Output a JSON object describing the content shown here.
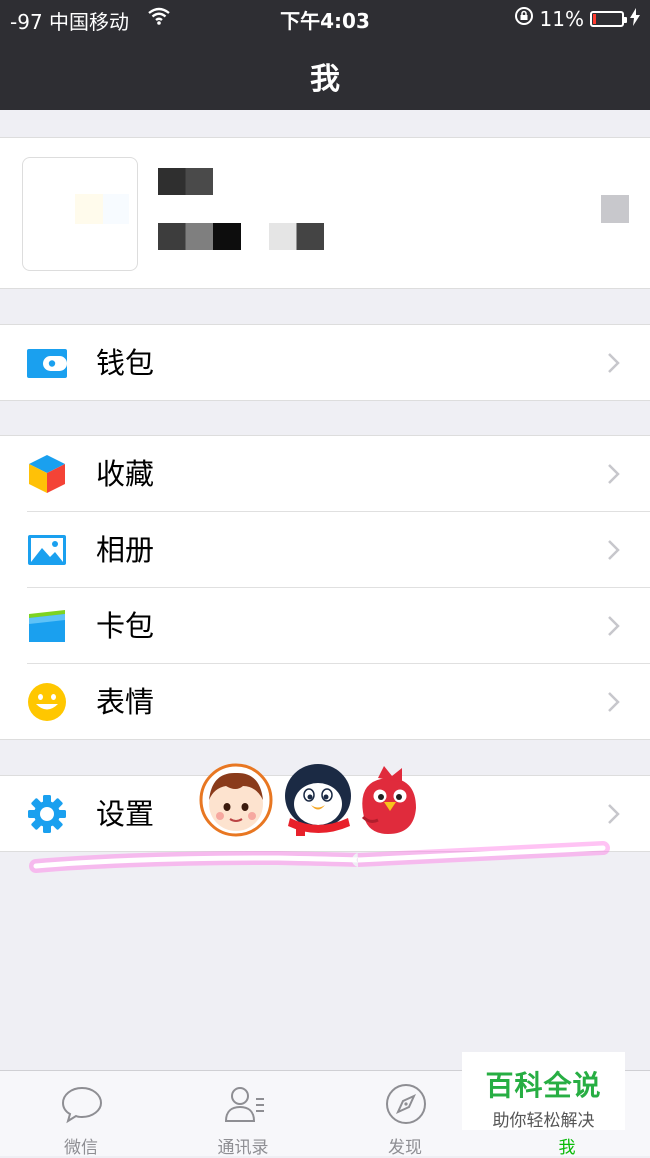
{
  "status_bar": {
    "carrier": "-97 中国移动",
    "time": "下午4:03",
    "battery_percent": "11%",
    "battery_level": 0.11
  },
  "nav": {
    "title": "我"
  },
  "menu": {
    "wallet": "钱包",
    "favorites": "收藏",
    "album": "相册",
    "card_wallet": "卡包",
    "stickers": "表情",
    "settings": "设置"
  },
  "tabs": [
    {
      "label": "微信",
      "icon": "chat-bubble-icon"
    },
    {
      "label": "通讯录",
      "icon": "contacts-icon"
    },
    {
      "label": "发现",
      "icon": "compass-icon"
    },
    {
      "label": "我",
      "icon": "me-icon",
      "active": true
    }
  ],
  "watermark": {
    "title": "百科全说",
    "subtitle": "助你轻松解决"
  },
  "colors": {
    "nav_bg": "#2e2e33",
    "page_bg": "#efeff4",
    "active_tab": "#09bb07",
    "wallet_blue": "#1aa0ef",
    "highlight": "#ff40d0"
  }
}
